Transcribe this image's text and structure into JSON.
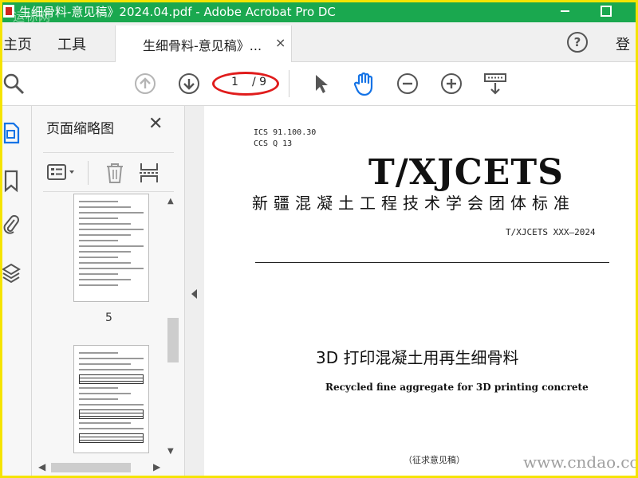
{
  "window": {
    "title": "生细骨料-意见稿》2024.04.pdf - Adobe Acrobat Pro DC",
    "watermark_logo": "运标网",
    "title_bar_color": "#1aa84f"
  },
  "tabs": {
    "home": "主页",
    "tools": "工具",
    "document": "生细骨料-意见稿》...",
    "close_glyph": "×",
    "help_glyph": "?",
    "sign_in": "登"
  },
  "toolbar": {
    "current_page": "1",
    "total_pages": "/ 9",
    "highlight_color": "#e01c1c"
  },
  "thumbnails_panel": {
    "title": "页面缩略图",
    "close_glyph": "✕",
    "visible_page_number": "5"
  },
  "document": {
    "ics": "ICS  91.100.30",
    "ccs": "CCS  Q 13",
    "code": "T/XJCETS",
    "organization": "新疆混凝土工程技术学会团体标准",
    "standard_number": "T/XJCETS XXX—2024",
    "title_cn": "3D 打印混凝土用再生细骨料",
    "title_en": "Recycled fine aggregate for 3D printing concrete",
    "draft_label": "（征求意见稿）"
  },
  "watermark": {
    "url": "www.cndao.com"
  }
}
